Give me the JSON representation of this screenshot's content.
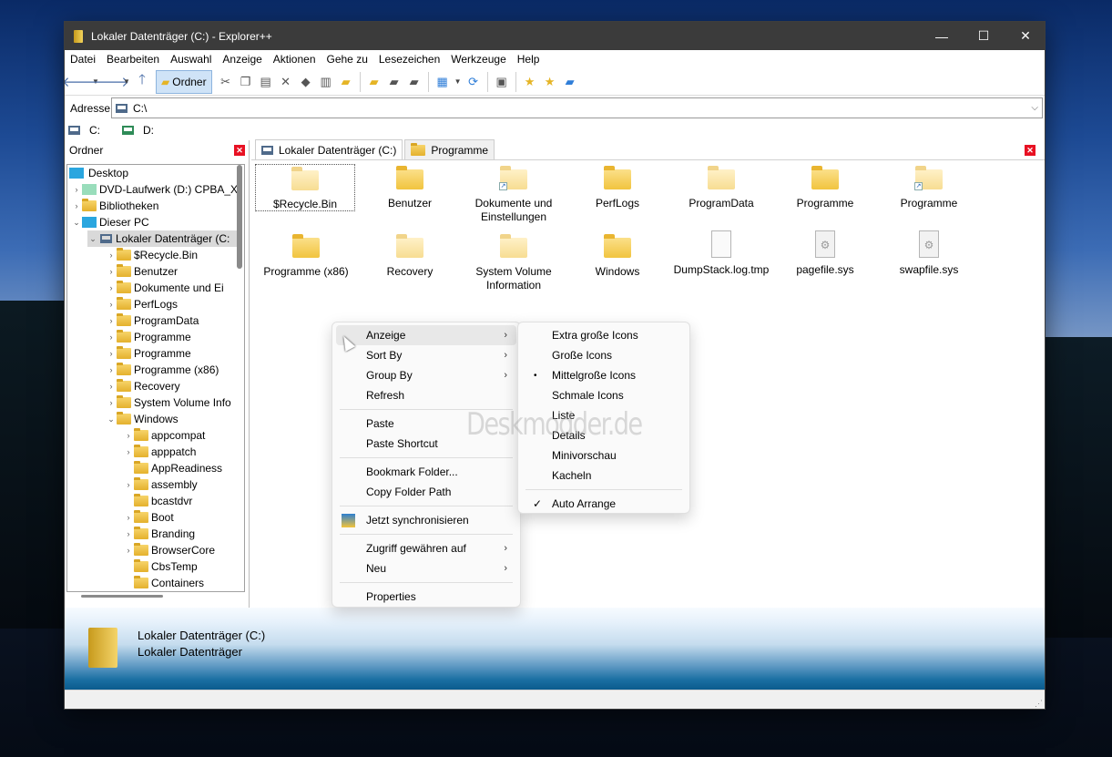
{
  "window": {
    "title": "Lokaler Datenträger (C:) - Explorer++",
    "minimize": "—",
    "maximize": "☐",
    "close": "✕"
  },
  "menu": [
    "Datei",
    "Bearbeiten",
    "Auswahl",
    "Anzeige",
    "Aktionen",
    "Gehe zu",
    "Lesezeichen",
    "Werkzeuge",
    "Help"
  ],
  "toolbar": {
    "ordner_label": "Ordner"
  },
  "address": {
    "label": "Adresse",
    "value": "C:\\"
  },
  "drives": [
    "C:",
    "D:"
  ],
  "folders_pane": {
    "title": "Ordner",
    "close": "✕"
  },
  "tree": [
    {
      "label": "Desktop"
    },
    {
      "label": "DVD-Laufwerk (D:) CPBA_X"
    },
    {
      "label": "Bibliotheken"
    },
    {
      "label": "Dieser PC"
    },
    {
      "label": "Lokaler Datenträger (C:"
    },
    {
      "label": "$Recycle.Bin"
    },
    {
      "label": "Benutzer"
    },
    {
      "label": "Dokumente und Ei"
    },
    {
      "label": "PerfLogs"
    },
    {
      "label": "ProgramData"
    },
    {
      "label": "Programme"
    },
    {
      "label": "Programme"
    },
    {
      "label": "Programme (x86)"
    },
    {
      "label": "Recovery"
    },
    {
      "label": "System Volume Info"
    },
    {
      "label": "Windows"
    },
    {
      "label": "appcompat"
    },
    {
      "label": "apppatch"
    },
    {
      "label": "AppReadiness"
    },
    {
      "label": "assembly"
    },
    {
      "label": "bcastdvr"
    },
    {
      "label": "Boot"
    },
    {
      "label": "Branding"
    },
    {
      "label": "BrowserCore"
    },
    {
      "label": "CbsTemp"
    },
    {
      "label": "Containers"
    }
  ],
  "tabs": [
    "Lokaler Datenträger (C:)",
    "Programme"
  ],
  "items_row1": [
    "$Recycle.Bin",
    "Benutzer",
    "Dokumente und Einstellungen",
    "PerfLogs",
    "ProgramData",
    "Programme",
    "Programme"
  ],
  "items_row2": [
    "Programme (x86)",
    "Recovery",
    "System Volume Information",
    "Windows",
    "DumpStack.log.tmp",
    "pagefile.sys",
    "swapfile.sys"
  ],
  "context_menu": {
    "anzeige": "Anzeige",
    "sort_by": "Sort By",
    "group_by": "Group By",
    "refresh": "Refresh",
    "paste": "Paste",
    "paste_shortcut": "Paste Shortcut",
    "bookmark_folder": "Bookmark Folder...",
    "copy_folder_path": "Copy Folder Path",
    "sync": "Jetzt synchronisieren",
    "grant_access": "Zugriff gewähren auf",
    "neu": "Neu",
    "properties": "Properties",
    "submenu_arrow": "›"
  },
  "view_submenu": {
    "extra_large": "Extra große Icons",
    "large": "Große Icons",
    "medium": "Mittelgroße Icons",
    "small": "Schmale Icons",
    "list": "Liste",
    "details": "Details",
    "thumbnails": "Minivorschau",
    "tiles": "Kacheln",
    "auto_arrange": "Auto Arrange",
    "bullet": "•",
    "check": "✓"
  },
  "details_pane": {
    "name": "Lokaler Datenträger (C:)",
    "type": "Lokaler Datenträger"
  },
  "watermark": "Deskmodder.de"
}
